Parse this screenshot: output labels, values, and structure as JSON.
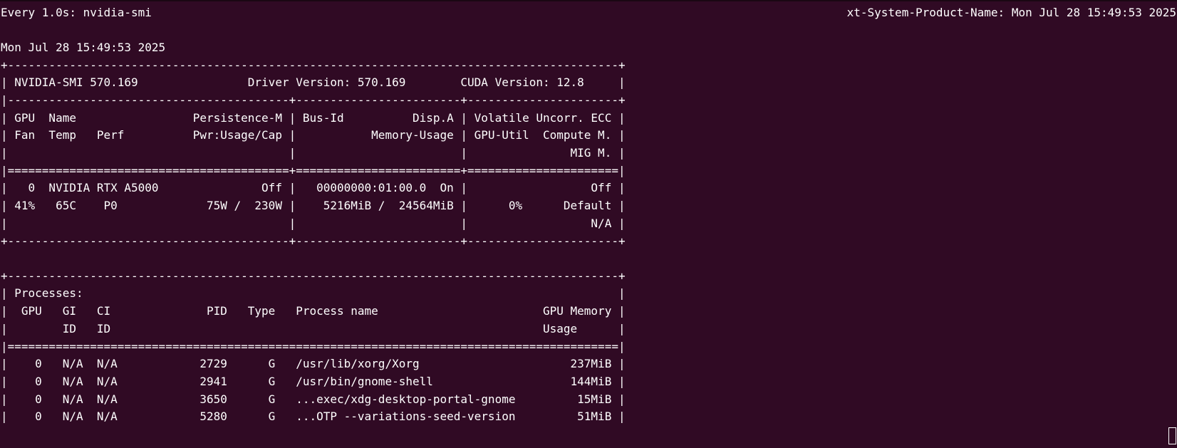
{
  "header": {
    "watch_command": "Every 1.0s: nvidia-smi",
    "host_time": "xt-System-Product-Name: Mon Jul 28 15:49:53 2025"
  },
  "timestamp": "Mon Jul 28 15:49:53 2025",
  "gpu_table": {
    "border_top": "+-----------------------------------------------------------------------------------------+",
    "info_line": "| NVIDIA-SMI 570.169                Driver Version: 570.169        CUDA Version: 12.8     |",
    "sep_line": "|-----------------------------------------+------------------------+----------------------+",
    "header_line1": "| GPU  Name                 Persistence-M | Bus-Id          Disp.A | Volatile Uncorr. ECC |",
    "header_line2": "| Fan  Temp   Perf          Pwr:Usage/Cap |           Memory-Usage | GPU-Util  Compute M. |",
    "header_line3": "|                                         |                        |               MIG M. |",
    "double_sep": "|=========================================+========================+======================|",
    "gpu_row1": "|   0  NVIDIA RTX A5000               Off |   00000000:01:00.0  On |                  Off |",
    "gpu_row2": "| 41%   65C    P0             75W /  230W |    5216MiB /  24564MiB |      0%      Default |",
    "gpu_row3": "|                                         |                        |                  N/A |",
    "border_bottom": "+-----------------------------------------+------------------------+----------------------+"
  },
  "proc_table": {
    "border_top": "+-----------------------------------------------------------------------------------------+",
    "title_line": "| Processes:                                                                              |",
    "header_line1": "|  GPU   GI   CI              PID   Type   Process name                        GPU Memory |",
    "header_line2": "|        ID   ID                                                               Usage      |",
    "double_sep": "|=========================================================================================|",
    "rows": [
      "|    0   N/A  N/A            2729      G   /usr/lib/xorg/Xorg                      237MiB |",
      "|    0   N/A  N/A            2941      G   /usr/bin/gnome-shell                    144MiB |",
      "|    0   N/A  N/A            3650      G   ...exec/xdg-desktop-portal-gnome         15MiB |",
      "|    0   N/A  N/A            5280      G   ...OTP --variations-seed-version         51MiB |"
    ]
  }
}
